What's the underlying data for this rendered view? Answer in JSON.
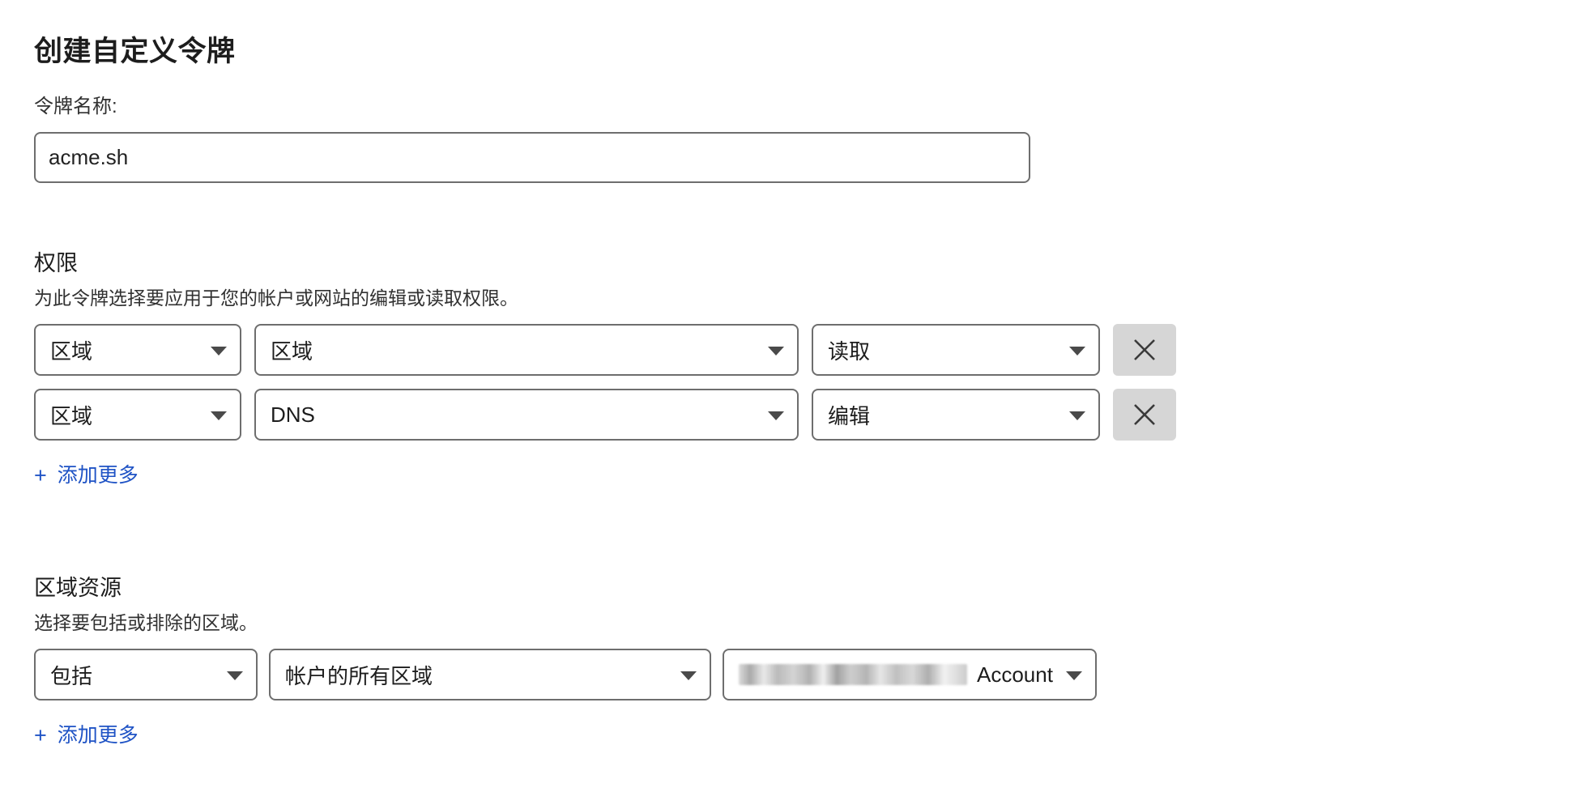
{
  "page": {
    "title": "创建自定义令牌"
  },
  "token_name": {
    "label": "令牌名称:",
    "value": "acme.sh",
    "placeholder": "令牌名称"
  },
  "permissions": {
    "heading": "权限",
    "description": "为此令牌选择要应用于您的帐户或网站的编辑或读取权限。",
    "rows": [
      {
        "scope": "区域",
        "resource": "区域",
        "access": "读取",
        "remove_label": "×"
      },
      {
        "scope": "区域",
        "resource": "DNS",
        "access": "编辑",
        "remove_label": "×"
      }
    ],
    "add_more": "添加更多",
    "add_more_plus": "+"
  },
  "zone_resources": {
    "heading": "区域资源",
    "description": "选择要包括或排除的区域。",
    "rows": [
      {
        "mode": "包括",
        "scope": "帐户的所有区域",
        "account": "Account",
        "account_redacted": true
      }
    ],
    "add_more": "添加更多",
    "add_more_plus": "+"
  },
  "colors": {
    "link": "#1f53c5",
    "border": "#6e6e6e",
    "remove_button_bg": "#d6d6d6",
    "text": "#1d1d1d",
    "background": "#ffffff"
  }
}
